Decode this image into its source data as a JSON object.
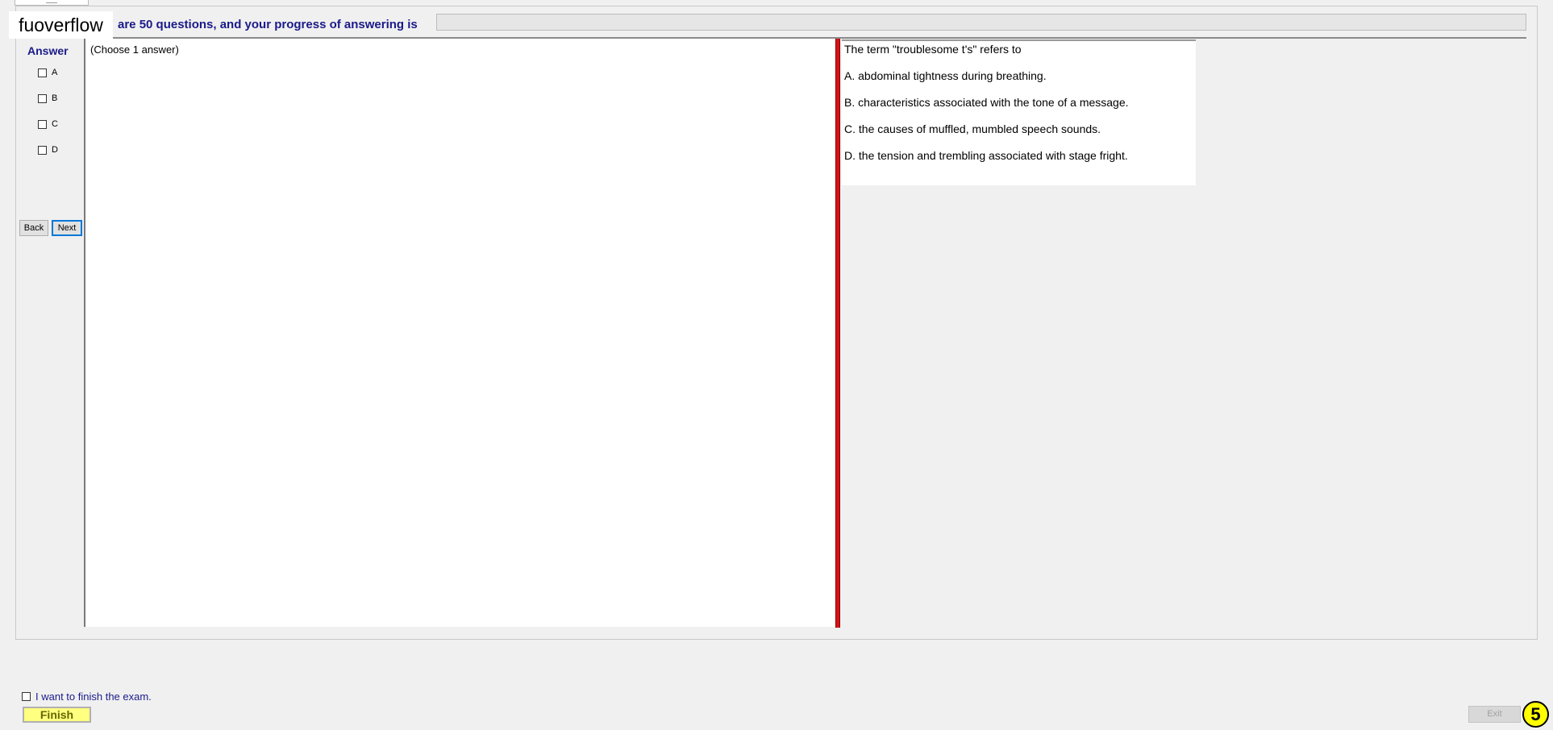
{
  "header": {
    "logo_text": "fuoverflow",
    "progress_text": "are 50 questions, and your progress of answering is",
    "progress_fraction": 0
  },
  "answer_panel": {
    "title": "Answer",
    "options": [
      "A",
      "B",
      "C",
      "D"
    ],
    "back_label": "Back",
    "next_label": "Next"
  },
  "content": {
    "instruction": "(Choose 1 answer)"
  },
  "question": {
    "stem": "The term \"troublesome t's\" refers to",
    "options": [
      "A.  abdominal tightness during breathing.",
      "B.  characteristics associated with the tone of a message.",
      "C.  the causes of muffled, mumbled speech sounds.",
      "D.  the tension and trembling associated with stage fright."
    ]
  },
  "footer": {
    "finish_check_label": "I want to finish the exam.",
    "finish_label": "Finish",
    "exit_label": "Exit",
    "step_badge": "5"
  },
  "colors": {
    "accent_text": "#1a1a8a",
    "splitter": "#d4141a",
    "finish_button": "#ffff80",
    "badge": "#ffff00"
  }
}
